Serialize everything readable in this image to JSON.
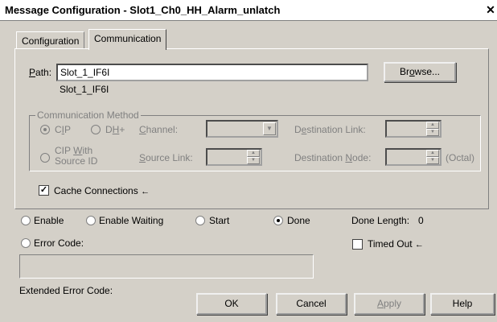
{
  "window": {
    "title": "Message Configuration - Slot1_Ch0_HH_Alarm_unlatch",
    "close_glyph": "✕"
  },
  "tabs": [
    {
      "label": "Configuration",
      "active": false
    },
    {
      "label": "Communication",
      "active": true
    }
  ],
  "path": {
    "label_hotkey": "P",
    "label_rest": "ath:",
    "value": "Slot_1_IF6I",
    "resolved": "Slot_1_IF6I",
    "browse_hotkey": "o",
    "browse_pre": "Br",
    "browse_post": "wse..."
  },
  "comm_method": {
    "title": "Communication Method",
    "cip": {
      "pre": "C",
      "hot": "I",
      "post": "P",
      "checked": true
    },
    "dhplus": {
      "pre": "D",
      "hot": "H",
      "post": "+",
      "checked": false
    },
    "channel": {
      "hot": "C",
      "rest": "hannel:"
    },
    "destination_link": {
      "pre": "D",
      "hot": "e",
      "post": "stination Link:"
    },
    "cip_with_source": {
      "line1_pre": "CIP ",
      "line1_hot": "W",
      "line1_post": "ith",
      "line2": "Source ID",
      "checked": false
    },
    "source_link": {
      "hot": "S",
      "rest": "ource Link:"
    },
    "destination_node": {
      "pre": "Destination ",
      "hot": "N",
      "post": "ode:"
    },
    "octal": "(Octal)"
  },
  "cache": {
    "checked": true,
    "label": "Cache Connections",
    "arrow": "←"
  },
  "status": {
    "enable": "Enable",
    "enable_waiting": "Enable Waiting",
    "start": "Start",
    "done": "Done",
    "done_checked": true,
    "done_length_label": "Done Length:",
    "done_length_value": "0",
    "error_code": "Error Code:",
    "timed_out": "Timed Out",
    "timed_out_checked": false,
    "timed_out_arrow": "←",
    "extended_error_code": "Extended Error Code:"
  },
  "buttons": {
    "ok": "OK",
    "cancel": "Cancel",
    "apply_hot": "A",
    "apply_rest": "pply",
    "help": "Help"
  },
  "colors": {
    "face": "#d4d0c8",
    "disabled_text": "#808080",
    "field_bg": "#ffffff"
  }
}
